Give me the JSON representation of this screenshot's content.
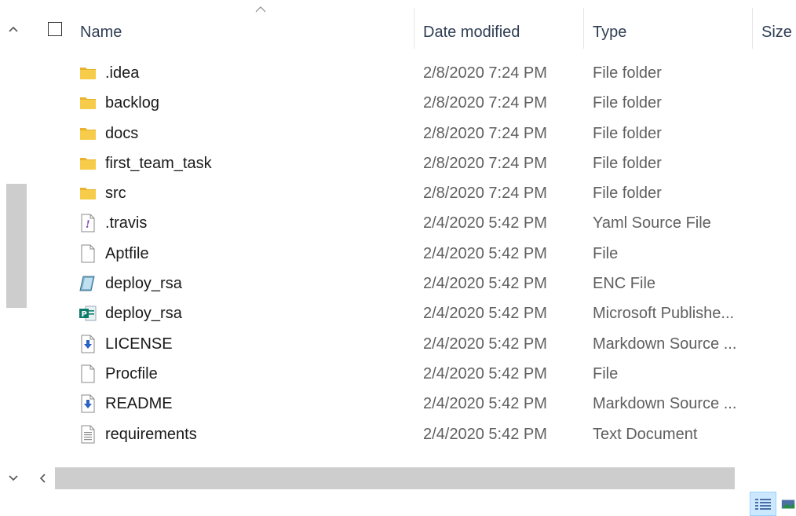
{
  "header": {
    "sort_indicator": "^",
    "columns": {
      "name": "Name",
      "date_modified": "Date modified",
      "type": "Type",
      "size": "Size"
    }
  },
  "files": [
    {
      "name": ".idea",
      "date": "2/8/2020 7:24 PM",
      "type": "File folder",
      "icon": "folder-icon"
    },
    {
      "name": "backlog",
      "date": "2/8/2020 7:24 PM",
      "type": "File folder",
      "icon": "folder-icon"
    },
    {
      "name": "docs",
      "date": "2/8/2020 7:24 PM",
      "type": "File folder",
      "icon": "folder-icon"
    },
    {
      "name": "first_team_task",
      "date": "2/8/2020 7:24 PM",
      "type": "File folder",
      "icon": "folder-icon"
    },
    {
      "name": "src",
      "date": "2/8/2020 7:24 PM",
      "type": "File folder",
      "icon": "folder-icon"
    },
    {
      "name": ".travis",
      "date": "2/4/2020 5:42 PM",
      "type": "Yaml Source File",
      "icon": "yaml-file-icon"
    },
    {
      "name": "Aptfile",
      "date": "2/4/2020 5:42 PM",
      "type": "File",
      "icon": "blank-file-icon"
    },
    {
      "name": "deploy_rsa",
      "date": "2/4/2020 5:42 PM",
      "type": "ENC File",
      "icon": "enc-file-icon"
    },
    {
      "name": "deploy_rsa",
      "date": "2/4/2020 5:42 PM",
      "type": "Microsoft Publishe...",
      "icon": "publisher-file-icon"
    },
    {
      "name": "LICENSE",
      "date": "2/4/2020 5:42 PM",
      "type": "Markdown Source ...",
      "icon": "markdown-file-icon"
    },
    {
      "name": "Procfile",
      "date": "2/4/2020 5:42 PM",
      "type": "File",
      "icon": "blank-file-icon"
    },
    {
      "name": "README",
      "date": "2/4/2020 5:42 PM",
      "type": "Markdown Source ...",
      "icon": "markdown-file-icon"
    },
    {
      "name": "requirements",
      "date": "2/4/2020 5:42 PM",
      "type": "Text Document",
      "icon": "text-file-icon"
    }
  ],
  "scrollbars": {
    "vertical_up": "^",
    "vertical_down": "v",
    "horizontal_left": "<"
  },
  "colors": {
    "folder": "#f3c33d",
    "selection": "#cce8ff",
    "scroll_thumb": "#cdcdcd"
  }
}
